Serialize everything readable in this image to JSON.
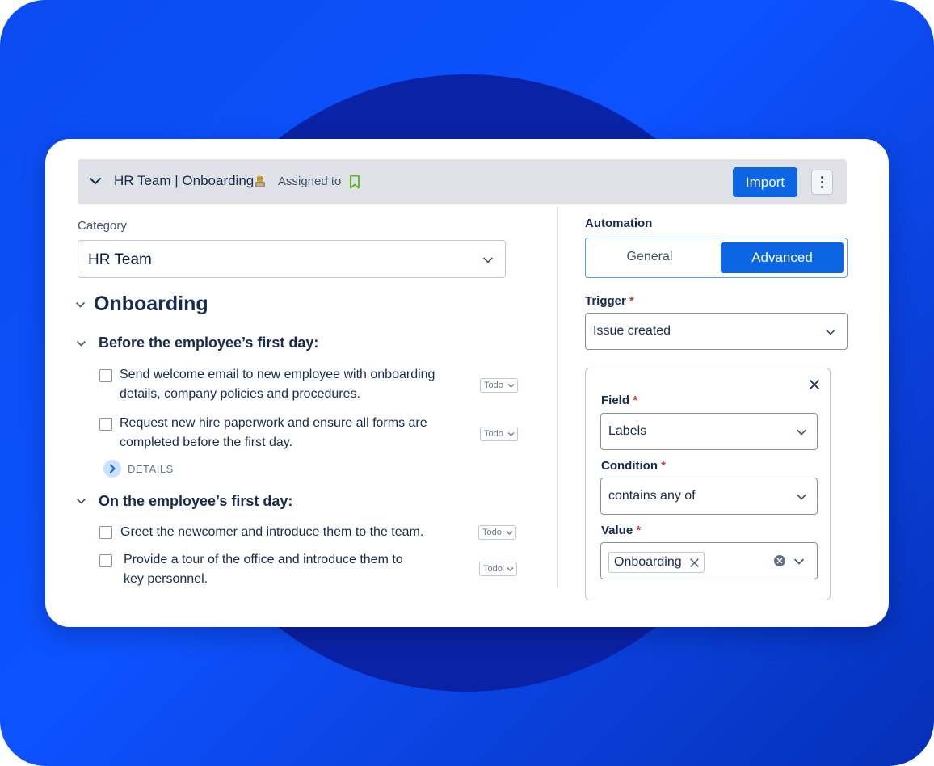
{
  "header": {
    "title": "HR Team | Onboarding",
    "assigned_label": "Assigned to",
    "import_label": "Import",
    "icons": [
      "chevron-down-icon",
      "robot-emoji-icon",
      "bookmark-icon",
      "more-vertical-icon"
    ]
  },
  "category": {
    "label": "Category",
    "value": "HR Team"
  },
  "checklist": {
    "title": "Onboarding",
    "sections": [
      {
        "title": "Before the employee’s first day:",
        "tasks": [
          {
            "text_line1": "Send welcome email to new employee with onboarding",
            "text_line2": "details, company policies and procedures.",
            "status": "Todo"
          },
          {
            "text_line1": "Request new hire paperwork and ensure all forms are",
            "text_line2": "completed before the first day.",
            "status": "Todo"
          }
        ],
        "details_label": "DETAILS"
      },
      {
        "title": "On the employee’s first day:",
        "tasks": [
          {
            "text_line1": "Greet the newcomer and introduce them to the team.",
            "status": "Todo"
          },
          {
            "text_line1": "Provide a tour of the office and introduce them to",
            "text_line2": "key personnel.",
            "status": "Todo"
          }
        ]
      }
    ]
  },
  "automation": {
    "label": "Automation",
    "tabs": [
      "General",
      "Advanced"
    ],
    "active_tab": "Advanced",
    "trigger": {
      "label": "Trigger",
      "required_mark": "*",
      "value": "Issue created"
    },
    "field": {
      "label": "Field",
      "required_mark": "*",
      "value": "Labels"
    },
    "condition": {
      "label": "Condition",
      "required_mark": "*",
      "value": "contains any of"
    },
    "value": {
      "label": "Value",
      "required_mark": "*",
      "chip": "Onboarding"
    }
  },
  "colors": {
    "accent": "#0c66e4",
    "background": "#0d52ff",
    "circle": "#0a22a6",
    "required": "#c9372c",
    "bookmark": "#5fb82a"
  }
}
